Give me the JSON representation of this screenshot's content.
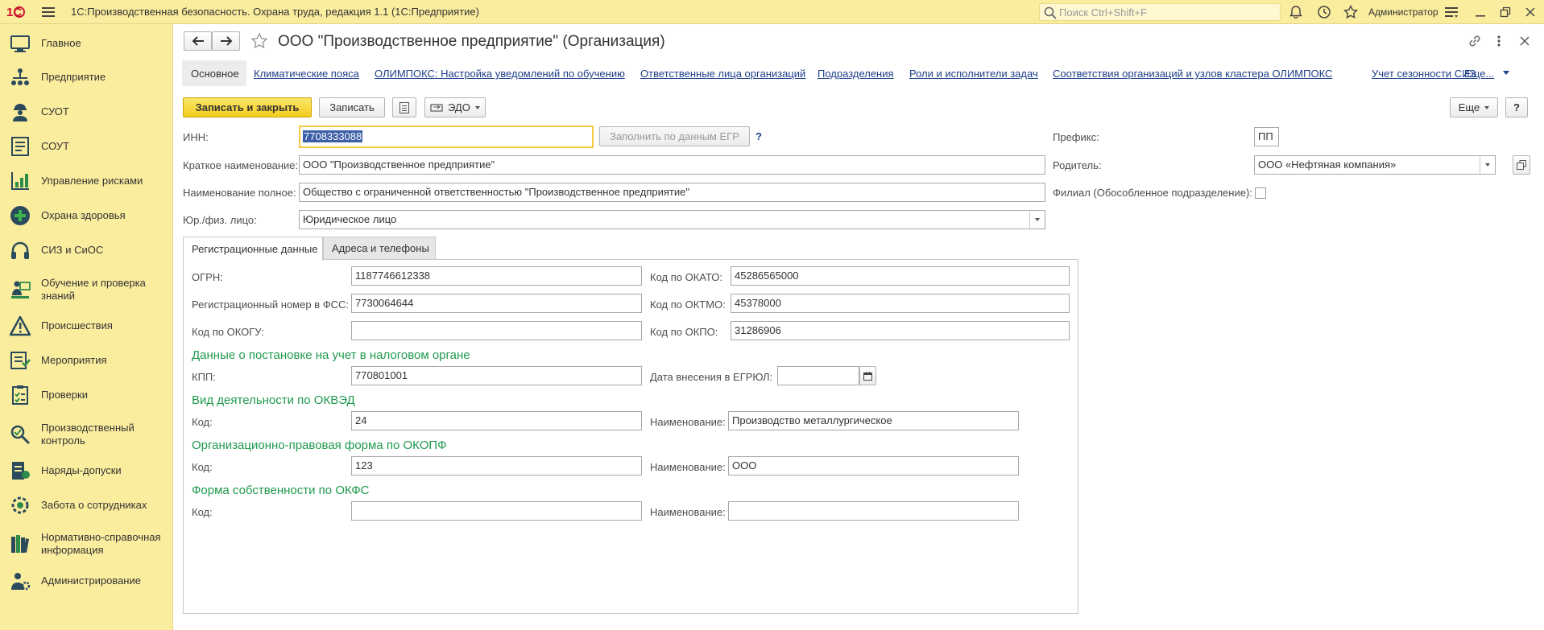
{
  "app": {
    "title": "1С:Производственная безопасность. Охрана труда, редакция 1.1  (1С:Предприятие)",
    "search_placeholder": "Поиск Ctrl+Shift+F",
    "user": "Администратор"
  },
  "sidebar": {
    "items": [
      {
        "label": "Главное",
        "icon": "home-icon"
      },
      {
        "label": "Предприятие",
        "icon": "org-structure-icon"
      },
      {
        "label": "СУОТ",
        "icon": "worker-icon"
      },
      {
        "label": "СОУТ",
        "icon": "document-icon"
      },
      {
        "label": "Управление рисками",
        "icon": "risk-chart-icon"
      },
      {
        "label": "Охрана здоровья",
        "icon": "medical-cross-icon"
      },
      {
        "label": "СИЗ и СиОС",
        "icon": "headphones-icon"
      },
      {
        "label": "Обучение и проверка знаний",
        "icon": "training-icon"
      },
      {
        "label": "Происшествия",
        "icon": "warning-icon"
      },
      {
        "label": "Мероприятия",
        "icon": "events-icon"
      },
      {
        "label": "Проверки",
        "icon": "checklist-icon"
      },
      {
        "label": "Производственный контроль",
        "icon": "control-icon"
      },
      {
        "label": "Наряды-допуски",
        "icon": "permit-icon"
      },
      {
        "label": "Забота о сотрудниках",
        "icon": "care-gear-icon"
      },
      {
        "label": "Нормативно-справочная информация",
        "icon": "books-icon"
      },
      {
        "label": "Администрирование",
        "icon": "admin-icon"
      }
    ]
  },
  "form": {
    "title": "ООО \"Производственное предприятие\" (Организация)",
    "nav": {
      "active": "Основное",
      "links": [
        "Климатические пояса",
        "ОЛИМПОКС: Настройка уведомлений по обучению",
        "Ответственные лица организаций",
        "Подразделения",
        "Роли и исполнители задач",
        "Соответствия организаций и узлов кластера ОЛИМПОКС",
        "Учет сезонности СИЗ",
        "Еще..."
      ]
    },
    "toolbar": {
      "save_close": "Записать и закрыть",
      "save": "Записать",
      "edo": "ЭДО",
      "more": "Еще",
      "help": "?"
    },
    "inn": {
      "label": "ИНН:",
      "value": "7708333088",
      "fill_button": "Заполнить по данным ЕГР",
      "help": "?"
    },
    "short_name": {
      "label": "Краткое наименование:",
      "value": "ООО \"Производственное предприятие\""
    },
    "full_name": {
      "label": "Наименование полное:",
      "value": "Общество с ограниченной ответственностью \"Производственное предприятие\""
    },
    "legal_type": {
      "label": "Юр./физ. лицо:",
      "value": "Юридическое лицо"
    },
    "prefix": {
      "label": "Префикс:",
      "value": "ПП"
    },
    "parent": {
      "label": "Родитель:",
      "value": "ООО «Нефтяная компания»"
    },
    "branch": {
      "label": "Филиал (Обособленное подразделение):"
    },
    "tabs": [
      "Регистрационные данные",
      "Адреса и телефоны"
    ],
    "reg": {
      "ogrn": {
        "label": "ОГРН:",
        "value": "1187746612338"
      },
      "fss": {
        "label": "Регистрационный номер в ФСС:",
        "value": "7730064644"
      },
      "okogu": {
        "label": "Код по ОКОГУ:",
        "value": ""
      },
      "okato": {
        "label": "Код по ОКАТО:",
        "value": "45286565000"
      },
      "oktmo": {
        "label": "Код по ОКТМО:",
        "value": "45378000"
      },
      "okpo": {
        "label": "Код по ОКПО:",
        "value": "31286906"
      },
      "tax_title": "Данные о постановке на учет в налоговом органе",
      "kpp": {
        "label": "КПП:",
        "value": "770801001"
      },
      "egrul": {
        "label": "Дата внесения в ЕГРЮЛ:",
        "value": " .  ."
      },
      "okved_title": "Вид деятельности по ОКВЭД",
      "okved_code": {
        "label": "Код:",
        "value": "24"
      },
      "okved_name": {
        "label": "Наименование:",
        "value": "Производство металлургическое"
      },
      "okopf_title": "Организационно-правовая форма по ОКОПФ",
      "okopf_code": {
        "label": "Код:",
        "value": "123"
      },
      "okopf_name": {
        "label": "Наименование:",
        "value": "ООО"
      },
      "okfs_title": "Форма собственности по ОКФС",
      "okfs_code": {
        "label": "Код:",
        "value": ""
      },
      "okfs_name": {
        "label": "Наименование:",
        "value": ""
      }
    }
  },
  "colors": {
    "panel": "#fbed9e",
    "accent_button": "#f5d21f",
    "group_title": "#1f9a4d",
    "link": "#1c3e8a"
  }
}
